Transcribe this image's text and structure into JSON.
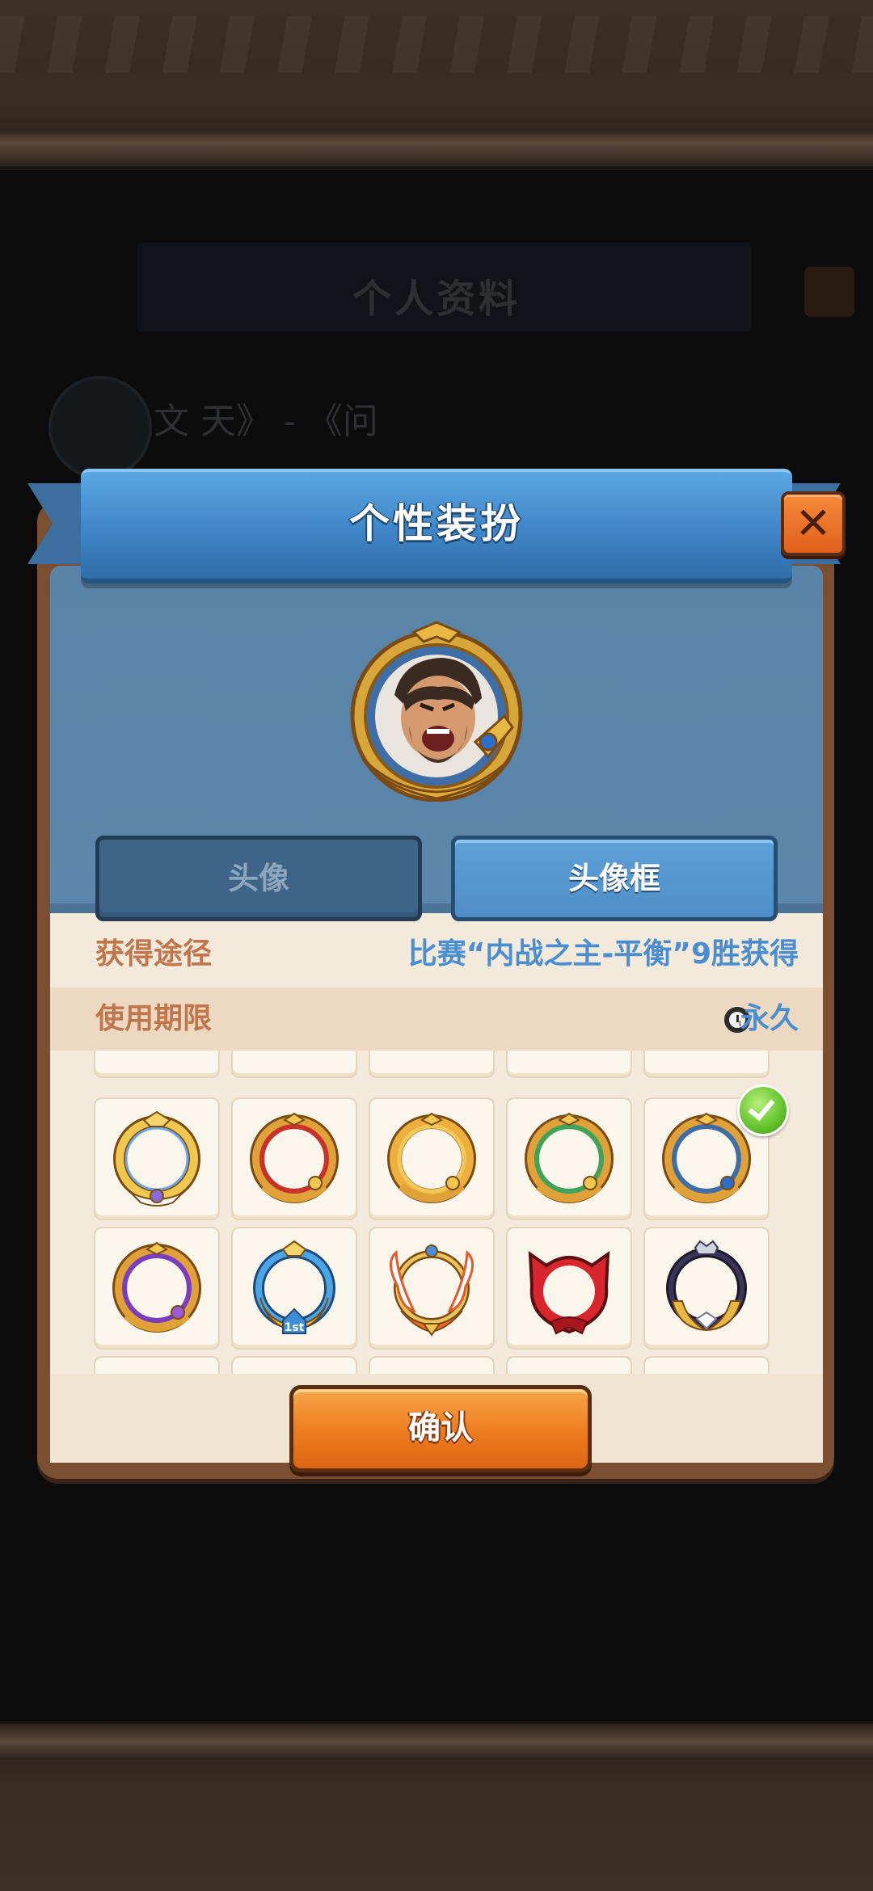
{
  "background": {
    "title": "个人资料",
    "name_text": "文 天》 - 《问"
  },
  "dialog": {
    "title": "个性装扮",
    "tabs": [
      {
        "label": "头像",
        "selected": false
      },
      {
        "label": "头像框",
        "selected": true
      }
    ],
    "source_label": "获得途径",
    "source_value": "比赛“内战之主-平衡”9胜获得",
    "duration_label": "使用期限",
    "duration_value": "永久",
    "confirm_label": "确认"
  },
  "frames": {
    "partial_row": [
      "frame-red-crown",
      "frame-green-crown",
      "frame-red-orb",
      "frame-silver-crown",
      "frame-gold-star"
    ],
    "row1": [
      "frame-gold-winged",
      "frame-red",
      "frame-gold",
      "frame-green",
      "frame-blue-selected"
    ],
    "row2": [
      "frame-purple",
      "frame-blue-1st",
      "frame-phoenix-wings",
      "frame-red-hood",
      "frame-dark-laurel"
    ],
    "selected": "frame-blue-selected",
    "first_place_badge": "1st"
  },
  "colors": {
    "ribbon_blue": "#3f86c9",
    "panel_brown": "#7a4f32",
    "label_orange": "#c0764a",
    "value_blue": "#4a8ed1",
    "confirm_orange": "#ee7f22",
    "close_orange": "#e0601c"
  }
}
